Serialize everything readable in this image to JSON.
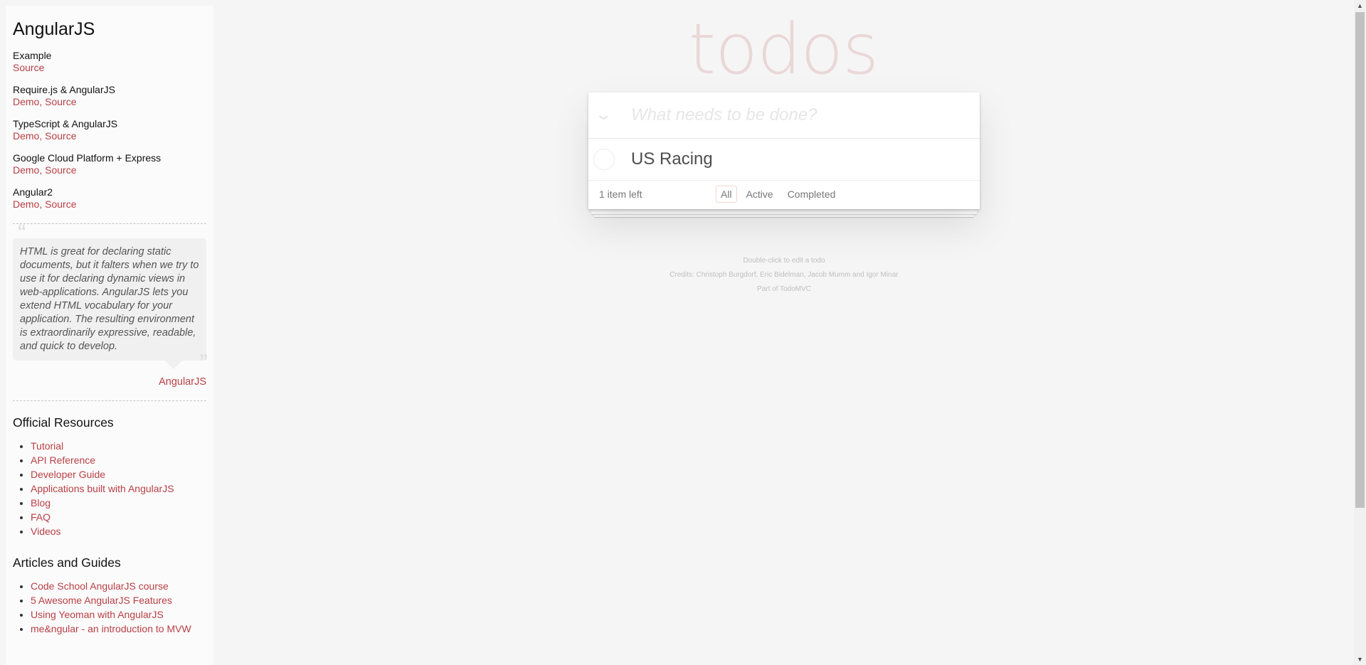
{
  "sidebar": {
    "title": "AngularJS",
    "examples": [
      {
        "name": "Example",
        "links": "Source"
      },
      {
        "name": "Require.js & AngularJS",
        "links": "Demo, Source"
      },
      {
        "name": "TypeScript & AngularJS",
        "links": "Demo, Source"
      },
      {
        "name": "Google Cloud Platform + Express",
        "links": "Demo, Source"
      },
      {
        "name": "Angular2",
        "links": "Demo, Source"
      }
    ],
    "quote": "HTML is great for declaring static documents, but it falters when we try to use it for declaring dynamic views in web-applications. AngularJS lets you extend HTML vocabulary for your application. The resulting environment is extraordinarily expressive, readable, and quick to develop.",
    "quote_source": "AngularJS",
    "official_resources": {
      "title": "Official Resources",
      "items": [
        "Tutorial",
        "API Reference",
        "Developer Guide",
        "Applications built with AngularJS",
        "Blog",
        "FAQ",
        "Videos"
      ]
    },
    "articles": {
      "title": "Articles and Guides",
      "items": [
        "Code School AngularJS course",
        "5 Awesome AngularJS Features",
        "Using Yeoman with AngularJS",
        "me&ngular - an introduction to MVW"
      ]
    }
  },
  "app": {
    "heading": "todos",
    "toggle_all_icon": "chevron-down-icon",
    "new_todo_placeholder": "What needs to be done?",
    "todos": [
      {
        "title": "US Racing",
        "completed": false
      }
    ],
    "count_text": "1 item left",
    "filters": [
      {
        "label": "All",
        "selected": true
      },
      {
        "label": "Active",
        "selected": false
      },
      {
        "label": "Completed",
        "selected": false
      }
    ]
  },
  "info": {
    "line1": "Double-click to edit a todo",
    "line2": "Credits: Christoph Burgdorf, Eric Bidelman, Jacob Mumm and Igor Minar",
    "line3": "Part of TodoMVC"
  },
  "colors": {
    "accent": "#b83f45",
    "background": "#f5f5f5",
    "heading": "rgba(175,47,47,0.15)"
  }
}
